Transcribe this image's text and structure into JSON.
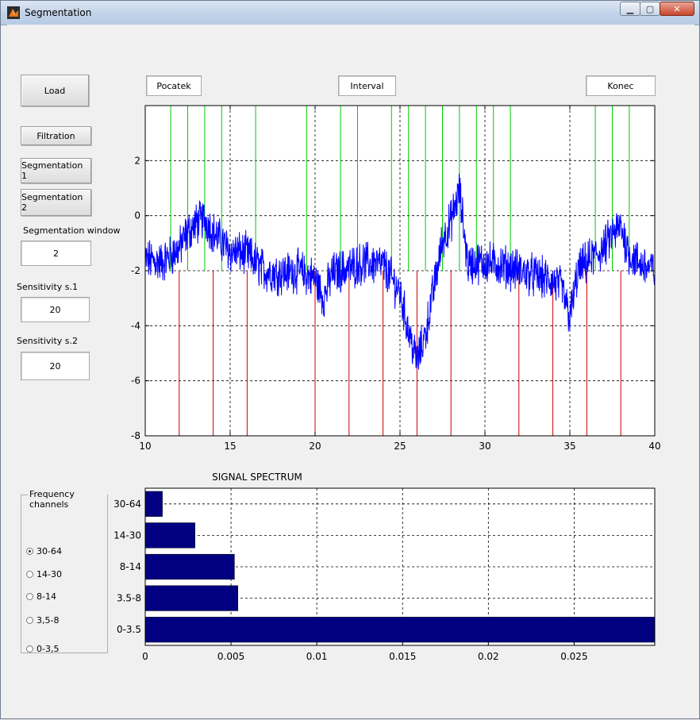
{
  "window": {
    "title": "Segmentation",
    "min_glyph": "▁",
    "max_glyph": "▢",
    "close_glyph": "✕"
  },
  "controls": {
    "load_label": "Load",
    "filtration_label": "Filtration",
    "segmentation1_label": "Segmentation 1",
    "segmentation2_label": "Segmentation 2",
    "seg_window_label": "Segmentation window",
    "seg_window_value": "2",
    "sens1_label": "Sensitivity s.1",
    "sens1_value": "20",
    "sens2_label": "Sensitivity s.2",
    "sens2_value": "20"
  },
  "boxes": {
    "pocatek": "Pocatek",
    "interval": "Interval",
    "konec": "Konec"
  },
  "freq_channels": {
    "title": "Frequency channels",
    "options": [
      "30-64",
      "14-30",
      "8-14",
      "3,5-8",
      "0-3,5"
    ],
    "selected_index": 0
  },
  "colors": {
    "signal": "#0000ff",
    "green_markers": "#00cc00",
    "red_markers": "#cc0000",
    "bars": "#000080"
  },
  "chart_data": [
    {
      "type": "line",
      "title": "",
      "xlim": [
        10,
        40
      ],
      "ylim": [
        -8,
        4
      ],
      "xticks": [
        10,
        15,
        20,
        25,
        30,
        35,
        40
      ],
      "yticks": [
        2,
        0,
        -2,
        -4,
        -6,
        -8
      ],
      "grid": true,
      "green_markers_x": [
        11.5,
        12.5,
        13.5,
        14.5,
        16.5,
        19.5,
        21.5,
        22.5,
        24.5,
        25.5,
        26.5,
        27.5,
        28.5,
        29.5,
        30.5,
        31.5,
        36.5,
        37.5,
        38.5
      ],
      "red_markers_x": [
        12,
        14,
        16,
        20,
        22,
        24,
        26,
        28,
        32,
        34,
        36,
        38
      ],
      "signal_envelope": {
        "x": [
          10,
          11,
          12,
          12.5,
          13,
          13.5,
          14,
          15,
          16,
          17,
          18,
          19,
          20,
          20.5,
          21,
          22,
          23,
          24,
          25,
          25.5,
          26,
          26.5,
          27,
          27.5,
          28,
          28.5,
          29,
          29.5,
          30,
          31,
          32,
          33,
          34,
          34.5,
          35,
          35.5,
          36,
          37,
          37.5,
          38,
          38.5,
          39,
          40
        ],
        "y": [
          -1.6,
          -1.7,
          -1.2,
          -0.6,
          -0.3,
          -0.1,
          -0.6,
          -1.3,
          -1.4,
          -2.0,
          -2.1,
          -2.0,
          -2.3,
          -3.0,
          -2.1,
          -1.9,
          -1.7,
          -1.8,
          -2.8,
          -4.2,
          -5.3,
          -4.3,
          -2.6,
          -0.9,
          -0.2,
          0.9,
          -1.8,
          -1.7,
          -1.7,
          -1.8,
          -2.0,
          -2.2,
          -2.4,
          -2.6,
          -3.7,
          -2.0,
          -1.7,
          -1.2,
          -0.7,
          -0.4,
          -1.4,
          -1.7,
          -2.0
        ]
      }
    },
    {
      "type": "bar",
      "orientation": "horizontal",
      "title": "SIGNAL SPECTRUM",
      "categories": [
        "30-64",
        "14-30",
        "8-14",
        "3.5-8",
        "0-3.5"
      ],
      "values": [
        0.001,
        0.0029,
        0.0052,
        0.0054,
        0.0297
      ],
      "xlim": [
        0,
        0.0297
      ],
      "xticks": [
        0,
        0.005,
        0.01,
        0.015,
        0.02,
        0.025
      ],
      "xtick_labels": [
        "0",
        "0.005",
        "0.01",
        "0.015",
        "0.02",
        "0.025"
      ],
      "grid": true
    }
  ]
}
